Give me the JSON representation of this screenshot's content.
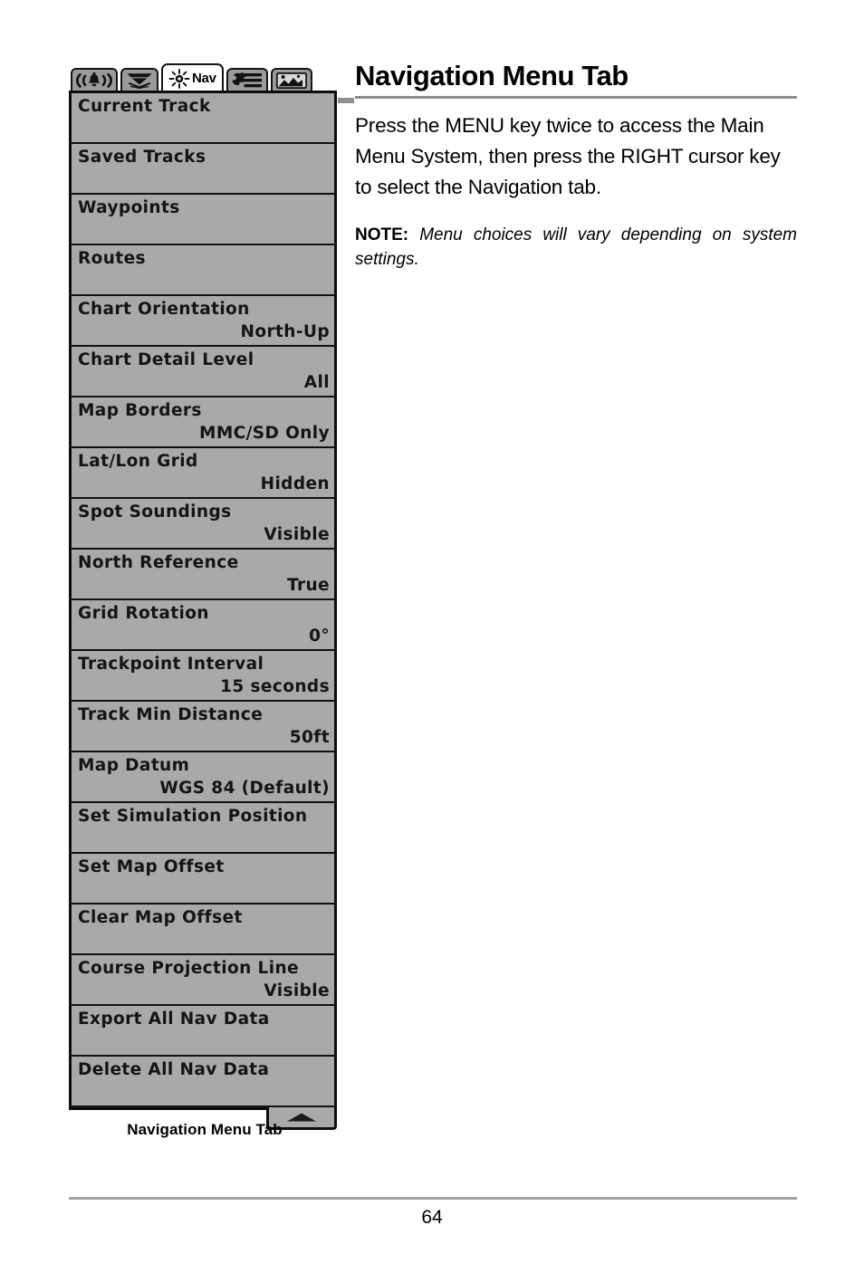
{
  "document": {
    "page_number": "64"
  },
  "article": {
    "title": "Navigation Menu Tab",
    "paragraph": "Press the MENU key twice to access the Main Menu System, then press the RIGHT cursor key to select the Navigation tab.",
    "note_lead": "NOTE:",
    "note_body": "Menu choices will vary depending on system settings."
  },
  "figure": {
    "caption": "Navigation Menu Tab",
    "tabs": [
      {
        "icon": "alarm-bell-icon",
        "label": "",
        "selected": false
      },
      {
        "icon": "sonar-cone-icon",
        "label": "",
        "selected": false
      },
      {
        "icon": "nav-compass-icon",
        "label": "Nav",
        "selected": true
      },
      {
        "icon": "setup-wrench-icon",
        "label": "",
        "selected": false
      },
      {
        "icon": "views-screen-icon",
        "label": "",
        "selected": false
      }
    ],
    "scroll_arrow_icon": "scroll-up-arrow-icon",
    "rows": [
      {
        "label": "Current Track",
        "value": ""
      },
      {
        "label": "Saved Tracks",
        "value": ""
      },
      {
        "label": "Waypoints",
        "value": ""
      },
      {
        "label": "Routes",
        "value": ""
      },
      {
        "label": "Chart Orientation",
        "value": "North-Up"
      },
      {
        "label": "Chart Detail Level",
        "value": "All"
      },
      {
        "label": "Map Borders",
        "value": "MMC/SD Only"
      },
      {
        "label": "Lat/Lon Grid",
        "value": "Hidden"
      },
      {
        "label": "Spot Soundings",
        "value": "Visible"
      },
      {
        "label": "North Reference",
        "value": "True"
      },
      {
        "label": "Grid Rotation",
        "value": "0°"
      },
      {
        "label": "Trackpoint Interval",
        "value": "15 seconds"
      },
      {
        "label": "Track Min Distance",
        "value": "50ft"
      },
      {
        "label": "Map Datum",
        "value": "WGS 84 (Default)"
      },
      {
        "label": "Set Simulation Position",
        "value": ""
      },
      {
        "label": "Set Map Offset",
        "value": ""
      },
      {
        "label": "Clear Map Offset",
        "value": ""
      },
      {
        "label": "Course Projection Line",
        "value": "Visible"
      },
      {
        "label": "Export All Nav Data",
        "value": ""
      },
      {
        "label": "Delete All Nav Data",
        "value": ""
      }
    ]
  },
  "colors": {
    "menu_background": "#a9a9a9",
    "menu_border": "#0d0d0d",
    "tab_inactive": "#9a9a9a",
    "tab_active": "#ffffff",
    "rule": "#8c8c8c"
  }
}
